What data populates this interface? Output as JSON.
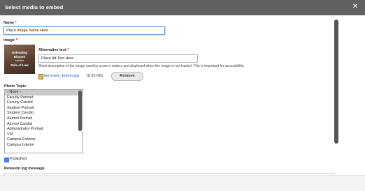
{
  "dialog": {
    "title": "Select media to embed",
    "close_icon": "close-icon"
  },
  "form": {
    "name_label": "Name",
    "name_value": "Place Image Name Here",
    "required_mark": "*",
    "image_label": "Image",
    "thumbnail": {
      "line1": "Defending",
      "line2": "Dissent",
      "line3": "and the",
      "line4": "Rule of Law"
    },
    "alt_label": "Alternative text",
    "alt_value": "Place Alt Text Here",
    "alt_description": "Short description of the image used by screen readers and displayed when the image is not loaded. This is important for accessibility.",
    "file_name": "bernstein_button.jpg",
    "file_size": "(8.95 KB)",
    "remove_button": "Remove",
    "photo_topic_label": "Photo Topic",
    "photo_topic_options": [
      "- None -",
      "Faculty Portrait",
      "Faculty Candid",
      "Student Portrait",
      "Student Candid",
      "Alumni Portrait",
      "Alumni Candid",
      "Administrator Portrait",
      "VIP",
      "Campus Exterior",
      "Campus Interior"
    ],
    "photo_topic_selected": "- None -",
    "published_label": "Published",
    "published_checked": true,
    "revision_label": "Revision log message"
  },
  "colors": {
    "titlebar": "#616161",
    "focus_border": "#6fa8dc",
    "link": "#1a5fb4",
    "required": "#e00000"
  }
}
